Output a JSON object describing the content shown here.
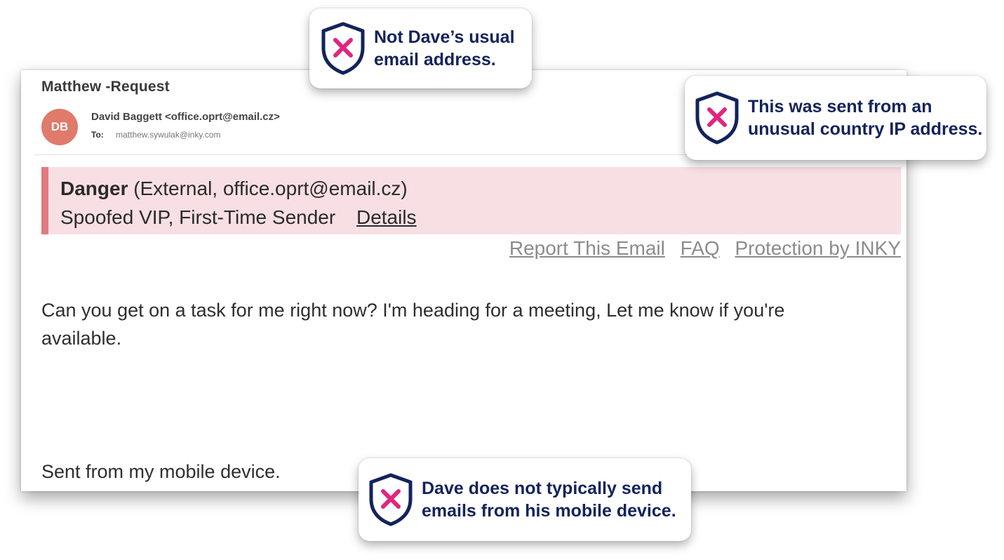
{
  "email": {
    "subject": "Matthew -Request",
    "avatar_initials": "DB",
    "from": "David Baggett <office.oprt@email.cz>",
    "to_label": "To:",
    "to_address": "matthew.sywulak@inky.com",
    "banner": {
      "level": "Danger",
      "context": "(External, office.oprt@email.cz)",
      "reasons": "Spoofed VIP, First-Time Sender",
      "details_link": "Details"
    },
    "links": {
      "report": "Report This Email",
      "faq": "FAQ",
      "protection": "Protection by INKY"
    },
    "body": "Can you get on a task for me right now? I'm heading for a meeting, Let me know if you're available.",
    "signature": "Sent from my mobile device."
  },
  "callouts": [
    {
      "text": "Not Dave’s usual email address."
    },
    {
      "text": "This was sent from an unusual country IP address."
    },
    {
      "text": "Dave does not typically send emails from his mobile device."
    }
  ],
  "colors": {
    "banner_bg": "#f7dfe3",
    "banner_accent": "#e07a80",
    "avatar": "#e07a6a",
    "callout_text": "#13235b",
    "warning_x": "#e0267f"
  }
}
